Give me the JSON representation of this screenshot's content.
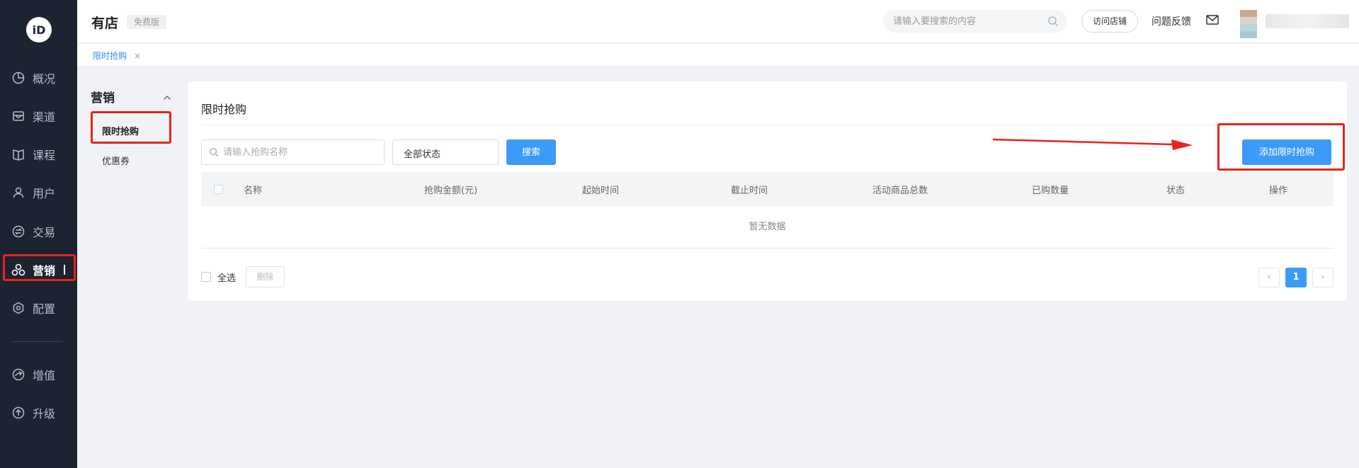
{
  "sidebar": {
    "logo_text": "iD",
    "items": [
      {
        "label": "概况",
        "icon": "pie-chart-icon"
      },
      {
        "label": "渠道",
        "icon": "store-icon"
      },
      {
        "label": "课程",
        "icon": "book-icon"
      },
      {
        "label": "用户",
        "icon": "user-icon"
      },
      {
        "label": "交易",
        "icon": "exchange-icon"
      },
      {
        "label": "营销",
        "icon": "marketing-icon",
        "active": true
      },
      {
        "label": "配置",
        "icon": "gear-icon"
      },
      {
        "label": "增值",
        "icon": "value-added-icon"
      },
      {
        "label": "升级",
        "icon": "upgrade-icon"
      }
    ]
  },
  "header": {
    "brand": "有店",
    "edition": "免费版",
    "search_placeholder": "请输入要搜索的内容",
    "visit_store": "访问店铺",
    "feedback": "问题反馈"
  },
  "tabs": [
    {
      "label": "限时抢购",
      "close": "×"
    }
  ],
  "submenu": {
    "title": "营销",
    "items": [
      {
        "label": "限时抢购",
        "active": true
      },
      {
        "label": "优惠券",
        "active": false
      }
    ]
  },
  "main": {
    "title": "限时抢购",
    "name_placeholder": "请输入抢购名称",
    "status_select": "全部状态",
    "search_button": "搜索",
    "add_button": "添加限时抢购",
    "table": {
      "columns": [
        "名称",
        "抢购金额(元)",
        "起始时间",
        "截止时间",
        "活动商品总数",
        "已购数量",
        "状态",
        "操作"
      ],
      "empty_text": "暂无数据"
    },
    "footer": {
      "select_all": "全选",
      "delete_button": "删除",
      "pager": {
        "prev": "‹",
        "current": "1",
        "next": "›"
      }
    }
  },
  "colors": {
    "sidebar_bg": "#1b2430",
    "primary": "#3c9af8",
    "annotation_red": "#e8231b"
  }
}
